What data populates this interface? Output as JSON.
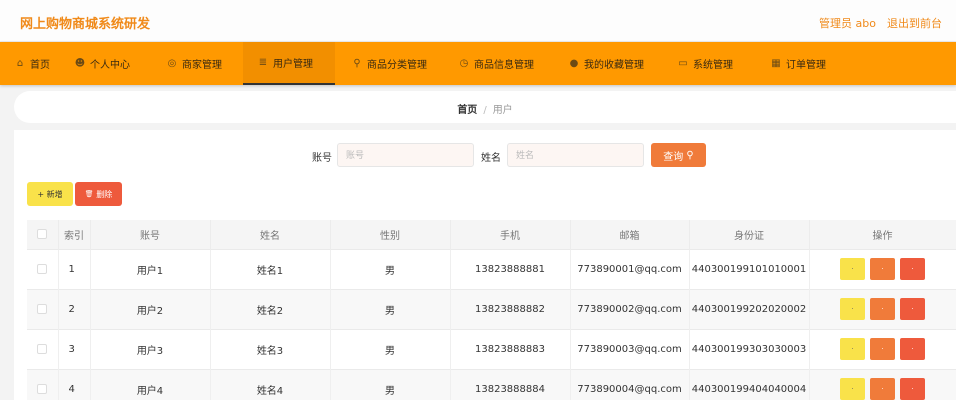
{
  "header": {
    "title": "网上购物商城系统研发",
    "user": "管理员 abo",
    "exit": "退出到前台"
  },
  "nav": {
    "items": [
      {
        "label": "首页",
        "icon": "⌂"
      },
      {
        "label": "个人中心",
        "icon": "☻"
      },
      {
        "label": "商家管理",
        "icon": "◎"
      },
      {
        "label": "用户管理",
        "icon": "≣"
      },
      {
        "label": "商品分类管理",
        "icon": "⚲"
      },
      {
        "label": "商品信息管理",
        "icon": "◷"
      },
      {
        "label": "我的收藏管理",
        "icon": "●"
      },
      {
        "label": "系统管理",
        "icon": "▭"
      },
      {
        "label": "订单管理",
        "icon": "▦"
      }
    ]
  },
  "breadcrumb": {
    "home": "首页",
    "sep": "/",
    "current": "用户"
  },
  "search": {
    "account_label": "账号",
    "account_placeholder": "账号",
    "name_label": "姓名",
    "name_placeholder": "姓名",
    "query_label": "查询",
    "query_icon": "⚲"
  },
  "actions": {
    "add_label": "新增",
    "add_icon": "+",
    "delete_label": "删除",
    "delete_icon": "🗑"
  },
  "table": {
    "headers": [
      "索引",
      "账号",
      "姓名",
      "性别",
      "手机",
      "邮箱",
      "身份证",
      "操作"
    ],
    "rows": [
      {
        "index": "1",
        "account": "用户1",
        "name": "姓名1",
        "gender": "男",
        "phone": "13823888881",
        "email": "773890001@qq.com",
        "id": "440300199101010001"
      },
      {
        "index": "2",
        "account": "用户2",
        "name": "姓名2",
        "gender": "男",
        "phone": "13823888882",
        "email": "773890002@qq.com",
        "id": "440300199202020002"
      },
      {
        "index": "3",
        "account": "用户3",
        "name": "姓名3",
        "gender": "男",
        "phone": "13823888883",
        "email": "773890003@qq.com",
        "id": "440300199303030003"
      },
      {
        "index": "4",
        "account": "用户4",
        "name": "姓名4",
        "gender": "男",
        "phone": "13823888884",
        "email": "773890004@qq.com",
        "id": "440300199404040004"
      }
    ],
    "op_mark": "·"
  }
}
